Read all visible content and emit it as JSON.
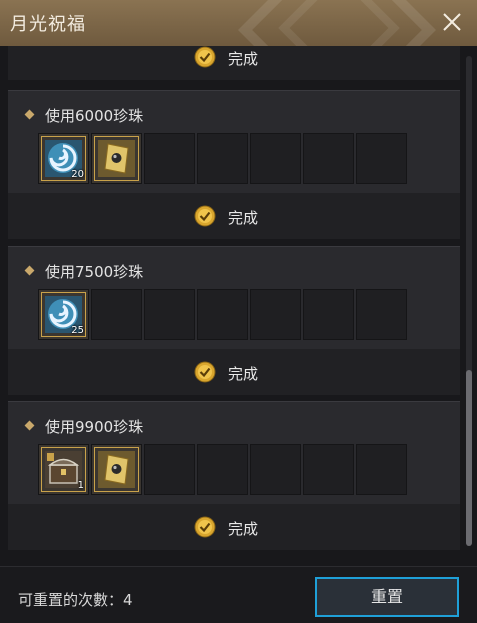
{
  "window": {
    "title": "月光祝福"
  },
  "complete_label": "完成",
  "sections": [
    {
      "title": "使用6000珍珠",
      "items": [
        {
          "icon": "swirl-orb-icon",
          "qty": "20"
        },
        {
          "icon": "pearl-card-icon",
          "qty": ""
        }
      ]
    },
    {
      "title": "使用7500珍珠",
      "items": [
        {
          "icon": "swirl-orb-icon",
          "qty": "25"
        }
      ]
    },
    {
      "title": "使用9900珍珠",
      "items": [
        {
          "icon": "treasure-chest-icon",
          "qty": "1"
        },
        {
          "icon": "pearl-card-icon",
          "qty": ""
        }
      ]
    }
  ],
  "footer": {
    "count_label": "可重置的次數：4",
    "reset_label": "重置"
  },
  "colors": {
    "title_bar": "#7a6446",
    "accent_gold": "#c9a24a",
    "button_border": "#1fa0d8"
  }
}
